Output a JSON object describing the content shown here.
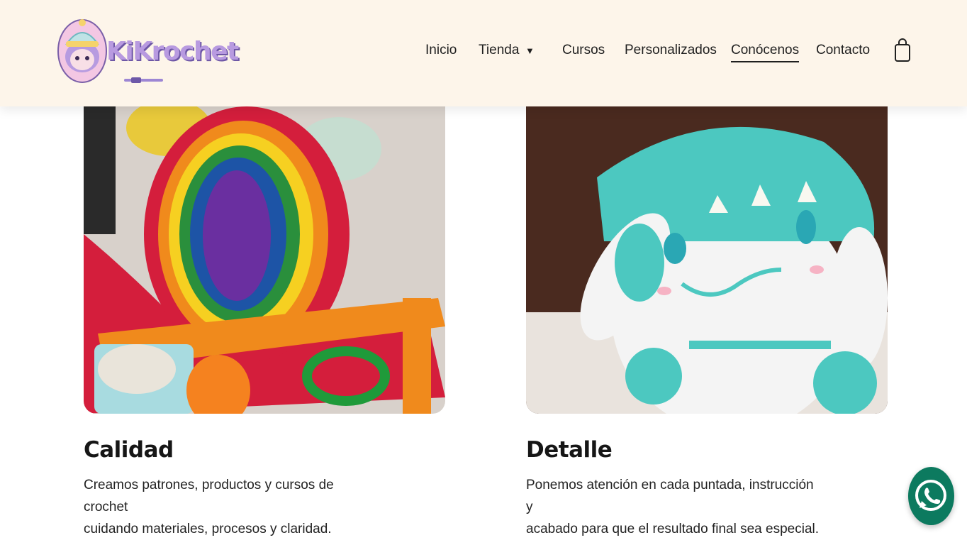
{
  "header": {
    "logo_text": "KiKrochet",
    "nav": [
      {
        "label": "Inicio"
      },
      {
        "label": "Tienda"
      },
      {
        "label": "Cursos"
      },
      {
        "label": "Personalizados"
      },
      {
        "label": "Conócenos"
      },
      {
        "label": "Contacto"
      }
    ],
    "active": "Conócenos",
    "cart_icon": "shopping-bag-icon"
  },
  "cards": [
    {
      "image": "rainbow-crochet-piece-photo",
      "title": "Calidad",
      "text_line1": "Creamos patrones, productos y cursos de crochet",
      "text_line2": "cuidando materiales, procesos y claridad."
    },
    {
      "image": "teal-bunny-amigurumi-photo",
      "title": "Detalle",
      "text_line1": "Ponemos atención en cada puntada, instrucción y",
      "text_line2": "acabado para que el resultado final sea especial."
    }
  ],
  "floating": {
    "whatsapp_icon": "whatsapp-icon",
    "color": "#0c7a5f"
  },
  "colors": {
    "header_bg": "#fdf5ea",
    "logo_purple": "#b89ae0"
  }
}
